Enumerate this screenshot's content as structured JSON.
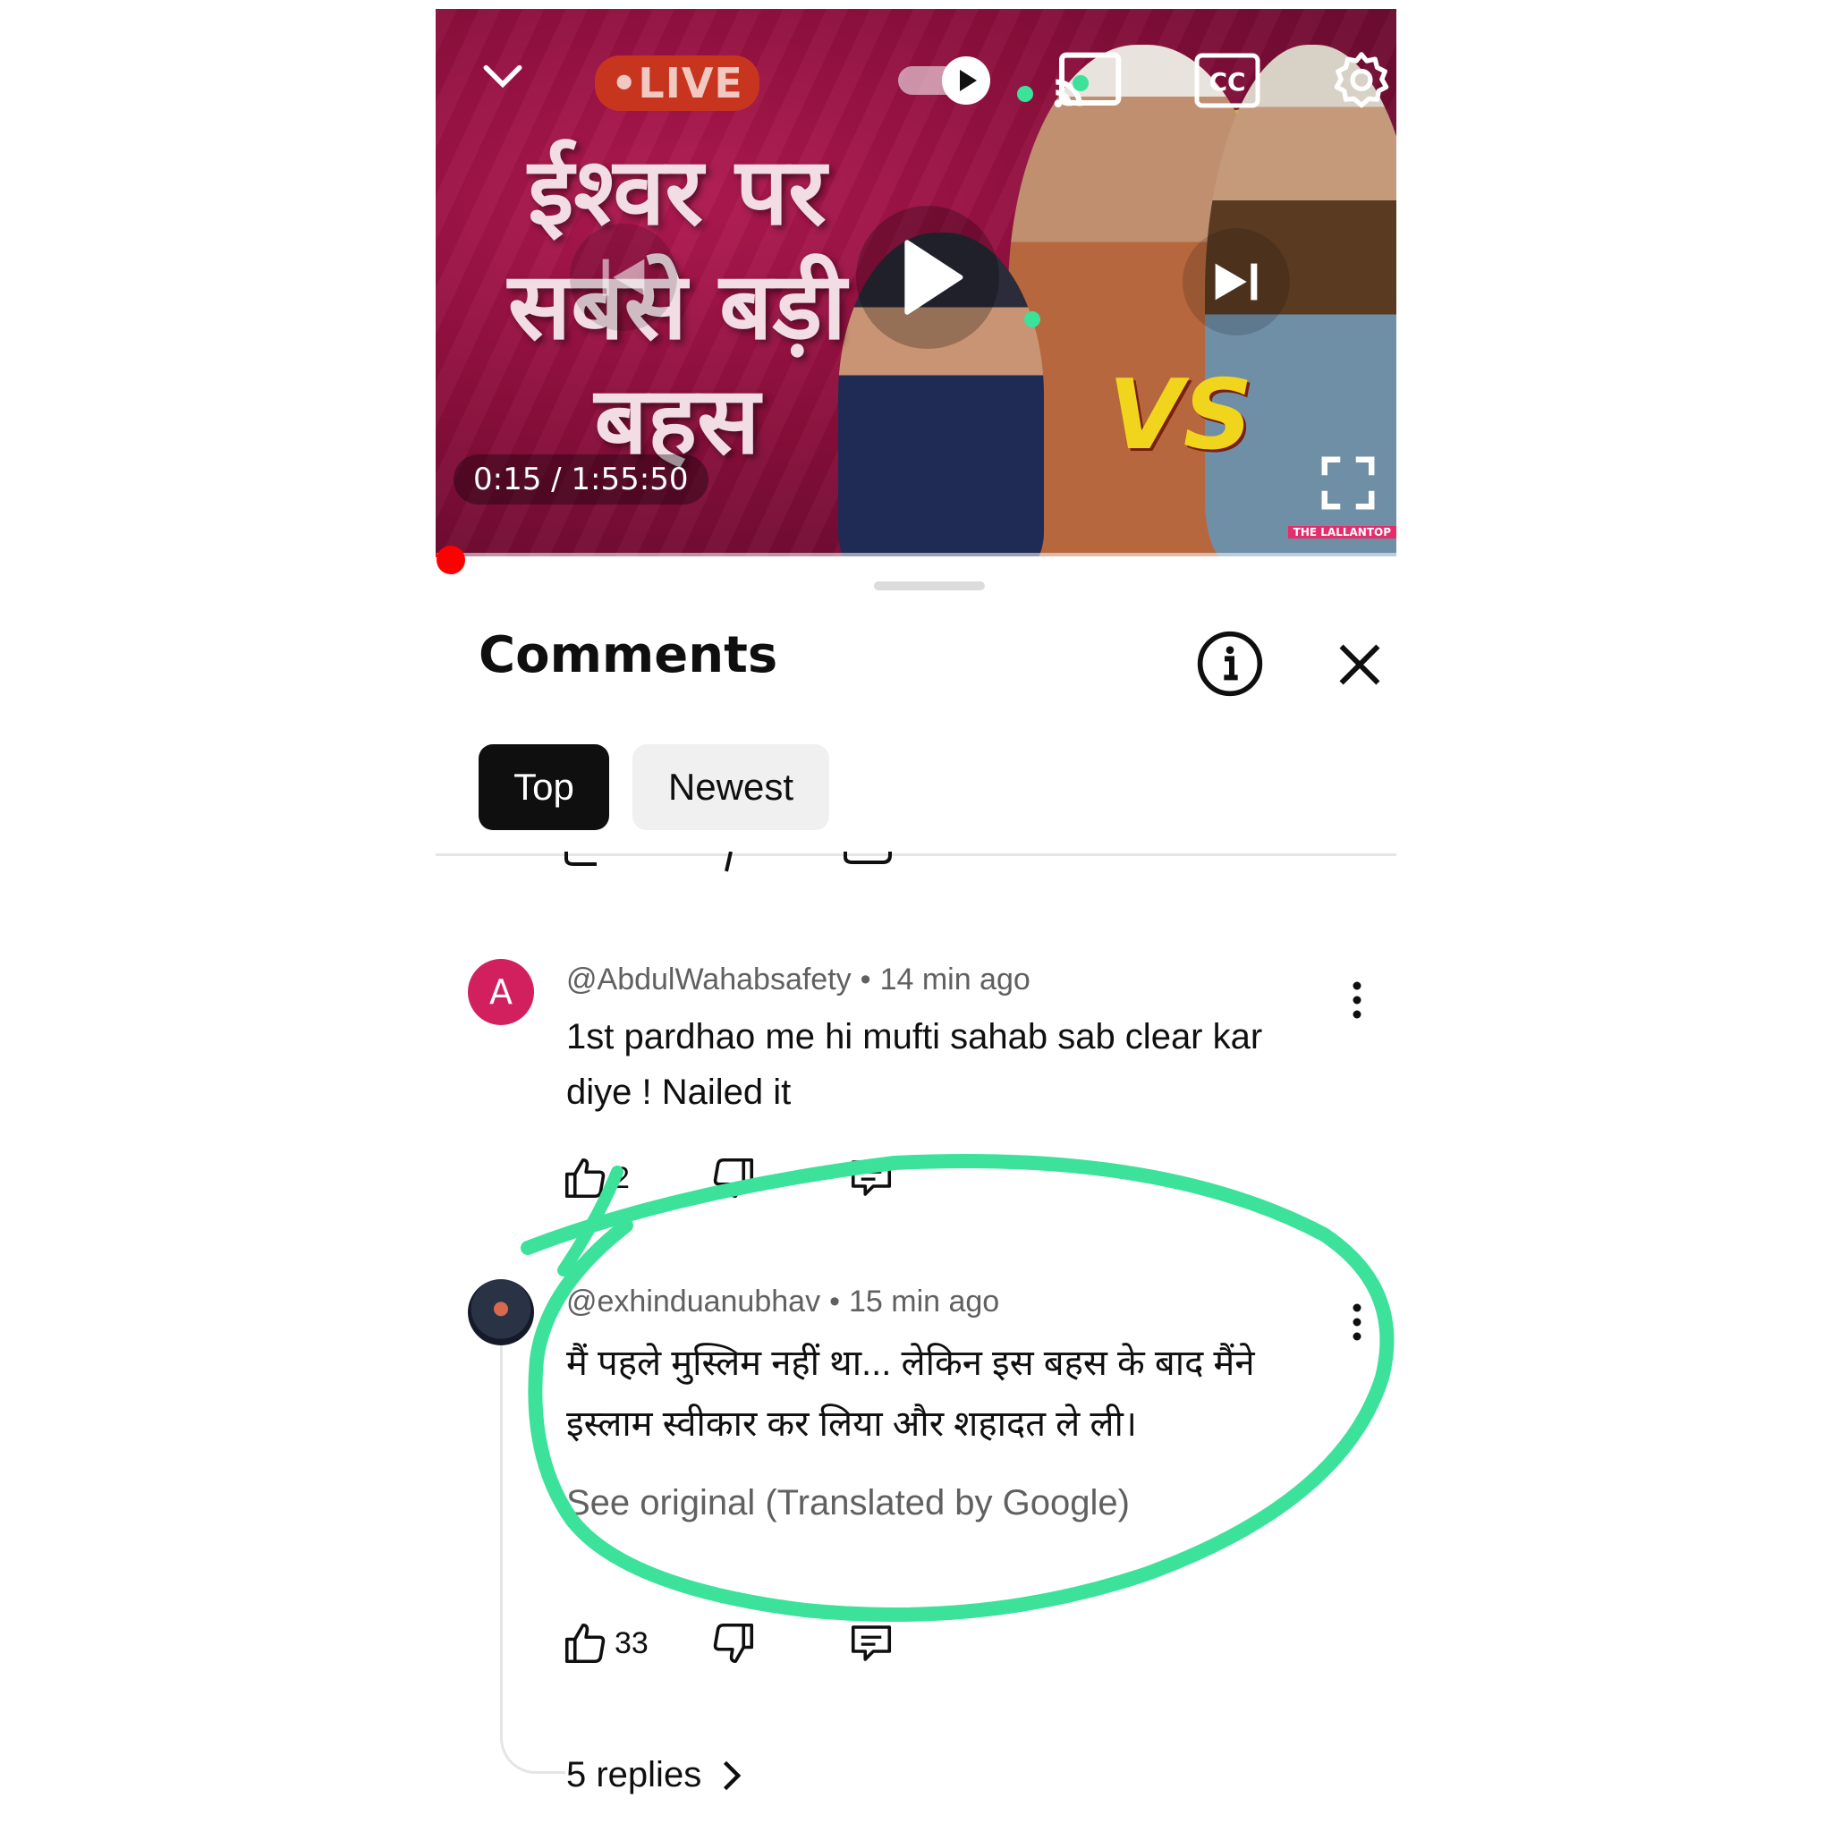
{
  "video": {
    "live_label": "•LIVE",
    "title_text": "ईश्वर पर सबसे बड़ी बहस",
    "vs_label": "VS",
    "time_display": "0:15 / 1:55:50",
    "progress_fraction": 0.002,
    "watermark": "THE LALLANTOP",
    "cc_label": "CC",
    "icons": [
      "chevron-down-icon",
      "autoplay-toggle-icon",
      "cast-icon",
      "cc-icon",
      "gear-icon",
      "previous-icon",
      "play-icon",
      "next-icon",
      "fullscreen-icon"
    ]
  },
  "comments_panel": {
    "title": "Comments",
    "tabs": [
      {
        "label": "Top",
        "selected": true
      },
      {
        "label": "Newest",
        "selected": false
      }
    ],
    "comments": [
      {
        "avatar_letter": "A",
        "avatar_color": "#d2205f",
        "author": "@AbdulWahabsafety",
        "time": "14 min ago",
        "text": "1st pardhao me hi mufti sahab sab clear kar diye ! Nailed it",
        "likes": "2"
      },
      {
        "author": "@exhinduanubhav",
        "time": "15 min ago",
        "text": "मैं पहले मुस्लिम नहीं था... लेकिन इस बहस के बाद मैंने इस्लाम स्वीकार कर लिया और शहादत ले ली।",
        "see_original": "See original (Translated by Google)",
        "likes": "33",
        "replies_label": "5 replies"
      }
    ]
  },
  "colors": {
    "highlight": "#3ce29a",
    "accent_red": "#ff0000",
    "text_primary": "#0f0f0f",
    "text_secondary": "#606060"
  }
}
